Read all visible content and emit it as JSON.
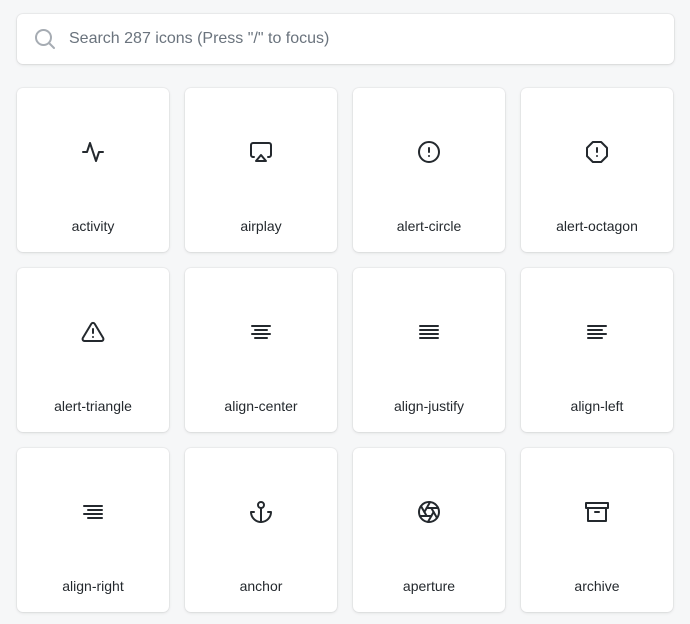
{
  "search": {
    "placeholder": "Search 287 icons (Press \"/\" to focus)",
    "value": "",
    "icon": "search-icon"
  },
  "icons": [
    {
      "label": "activity",
      "icon": "activity-icon"
    },
    {
      "label": "airplay",
      "icon": "airplay-icon"
    },
    {
      "label": "alert-circle",
      "icon": "alert-circle-icon"
    },
    {
      "label": "alert-octagon",
      "icon": "alert-octagon-icon"
    },
    {
      "label": "alert-triangle",
      "icon": "alert-triangle-icon"
    },
    {
      "label": "align-center",
      "icon": "align-center-icon"
    },
    {
      "label": "align-justify",
      "icon": "align-justify-icon"
    },
    {
      "label": "align-left",
      "icon": "align-left-icon"
    },
    {
      "label": "align-right",
      "icon": "align-right-icon"
    },
    {
      "label": "anchor",
      "icon": "anchor-icon"
    },
    {
      "label": "aperture",
      "icon": "aperture-icon"
    },
    {
      "label": "archive",
      "icon": "archive-icon"
    }
  ],
  "colors": {
    "background": "#f6f7f8",
    "card": "#ffffff",
    "text": "#24292e",
    "placeholder": "#6a737d",
    "search_icon": "#a6acb3"
  }
}
